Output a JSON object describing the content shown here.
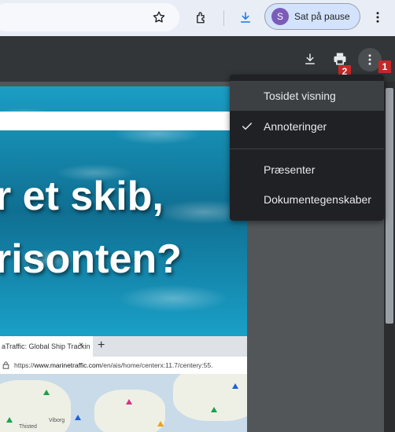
{
  "browser": {
    "profile": {
      "initial": "S",
      "label": "Sat på pause"
    }
  },
  "menu": {
    "items": [
      {
        "label": "Tosidet visning",
        "checked": false
      },
      {
        "label": "Annoteringer",
        "checked": true
      },
      {
        "label": "Præsenter",
        "checked": false
      },
      {
        "label": "Dokumentegenskaber",
        "checked": false
      }
    ]
  },
  "badges": {
    "more": "1",
    "print": "2"
  },
  "document": {
    "headline_line1": "r et skib,",
    "headline_line2": "risonten?",
    "screenshot": {
      "tab_title": "aTraffic: Global Ship Trackin",
      "tab_close": "×",
      "new_tab": "+",
      "url_prefix": "https://",
      "url_domain": "www.marinetraffic.com",
      "url_path": "/en/ais/home/centerx:11.7/centery:55.",
      "map_labels": [
        "Viborg",
        "Thisted"
      ]
    }
  },
  "colors": {
    "pdf_toolbar": "#323639",
    "menu_bg": "#202124",
    "badge": "#c62828",
    "profile_chip": "#d3e3fd"
  }
}
